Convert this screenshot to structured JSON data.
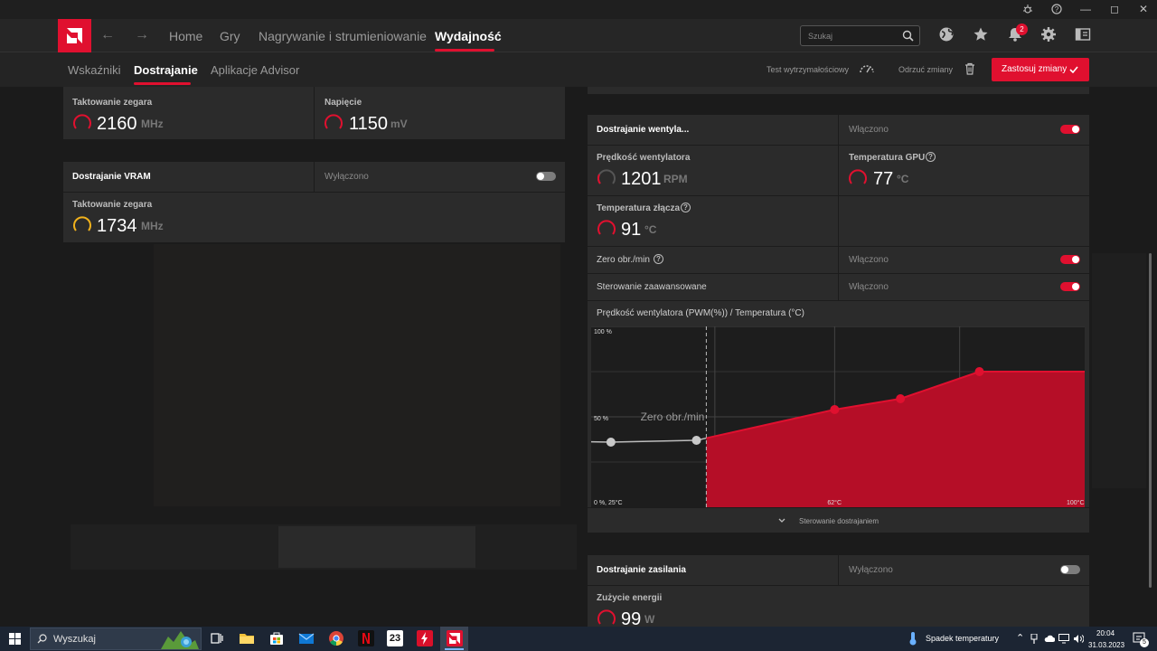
{
  "window": {
    "min": "—",
    "max": "◻",
    "close": "✕"
  },
  "nav": {
    "items": [
      "Home",
      "Gry",
      "Nagrywanie i strumieniowanie",
      "Wydajność"
    ],
    "active": "Wydajność",
    "search_placeholder": "Szukaj",
    "notification_count": "2"
  },
  "subnav": {
    "tabs": [
      "Wskaźniki",
      "Dostrajanie",
      "Aplikacje Advisor"
    ],
    "active": "Dostrajanie",
    "stress_test": "Test wytrzymałościowy",
    "discard": "Odrzuć zmiany",
    "apply": "Zastosuj zmiany"
  },
  "gpu": {
    "clock_label": "Taktowanie zegara",
    "clock_value": "2160",
    "clock_unit": "MHz",
    "voltage_label": "Napięcie",
    "voltage_value": "1150",
    "voltage_unit": "mV"
  },
  "vram": {
    "title": "Dostrajanie VRAM",
    "state": "Wyłączono",
    "clock_label": "Taktowanie zegara",
    "clock_value": "1734",
    "clock_unit": "MHz"
  },
  "fan": {
    "title": "Dostrajanie wentyla...",
    "state": "Włączono",
    "speed_label": "Prędkość wentylatora",
    "speed_value": "1201",
    "speed_unit": "RPM",
    "gpu_temp_label": "Temperatura GPU",
    "gpu_temp_value": "77",
    "gpu_temp_unit": "°C",
    "junction_label": "Temperatura złącza",
    "junction_value": "91",
    "junction_unit": "°C",
    "zero_rpm_label": "Zero obr./min",
    "zero_rpm_state": "Włączono",
    "advanced_label": "Sterowanie zaawansowane",
    "advanced_state": "Włączono",
    "curve_title": "Prędkość wentylatora (PWM(%)) / Temperatura (°C)",
    "footer": "Sterowanie dostrajaniem"
  },
  "chart_data": {
    "type": "line",
    "title": "Prędkość wentylatora (PWM(%)) / Temperatura (°C)",
    "y_tick_labels": [
      "100 %",
      "50 %"
    ],
    "x_tick_labels": [
      "0 %, 25°C",
      "62°C",
      "100°C"
    ],
    "xlim": [
      25,
      100
    ],
    "ylim": [
      0,
      100
    ],
    "zero_rpm_label": "Zero obr./min",
    "zero_rpm_threshold_x": 41,
    "points": [
      {
        "x": 28,
        "y": 36
      },
      {
        "x": 41,
        "y": 37
      },
      {
        "x": 62,
        "y": 54
      },
      {
        "x": 72,
        "y": 60
      },
      {
        "x": 84,
        "y": 75
      },
      {
        "x": 99,
        "y": 75
      }
    ],
    "accent": "#e0102f"
  },
  "power": {
    "title": "Dostrajanie zasilania",
    "state": "Wyłączono",
    "usage_label": "Zużycie energii",
    "usage_value": "99",
    "usage_unit": "W"
  },
  "taskbar": {
    "search": "Wyszukaj",
    "weather": "Spadek temperatury",
    "time": "20:04",
    "date": "31.03.2023",
    "app_label": "23",
    "notif": "5"
  },
  "colors": {
    "accent": "#e0102f",
    "gauge_yellow": "#f1b21c"
  }
}
